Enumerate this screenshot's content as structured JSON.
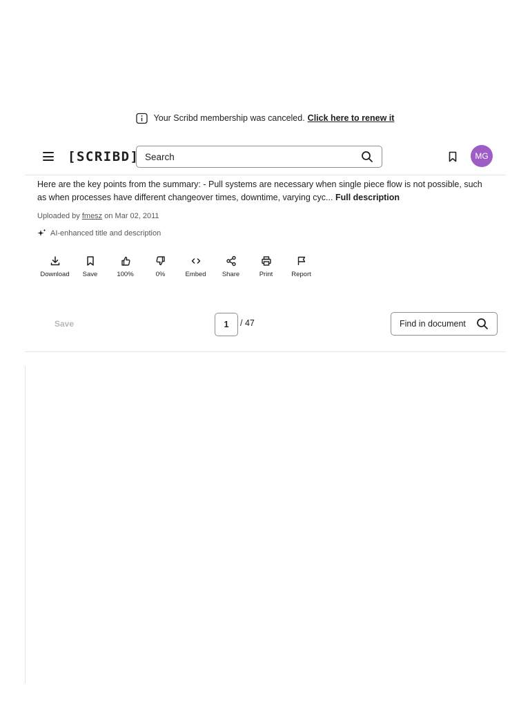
{
  "banner": {
    "message": "Your Scribd membership was canceled.",
    "link_label": "Click here to renew it",
    "icon": "info-icon"
  },
  "header": {
    "logo_text": "[SCRIBD]",
    "search_placeholder": "Search",
    "avatar_initials": "MG",
    "avatar_color": "#9e5cc5"
  },
  "document": {
    "description": "Here are the key points from the summary: - Pull systems are necessary when single piece flow is not possible, such as when processes have different changeover times, downtime, varying cyc...",
    "full_description_label": "Full description",
    "uploaded_by_prefix": "Uploaded by",
    "uploader_name": "fmesz",
    "uploaded_on": "on Mar 02, 2011",
    "ai_label": "AI-enhanced title and description"
  },
  "actions": [
    {
      "label": "Download",
      "icon": "download-icon"
    },
    {
      "label": "Save",
      "icon": "bookmark-icon"
    },
    {
      "label": "100%",
      "icon": "thumbs-up-icon"
    },
    {
      "label": "0%",
      "icon": "thumbs-down-icon"
    },
    {
      "label": "Embed",
      "icon": "embed-icon"
    },
    {
      "label": "Share",
      "icon": "share-icon"
    },
    {
      "label": "Print",
      "icon": "print-icon"
    },
    {
      "label": "Report",
      "icon": "flag-icon"
    }
  ],
  "toolbar": {
    "save_label": "Save",
    "current_page": "1",
    "total_pages": "/ 47",
    "find_label": "Find in document"
  }
}
